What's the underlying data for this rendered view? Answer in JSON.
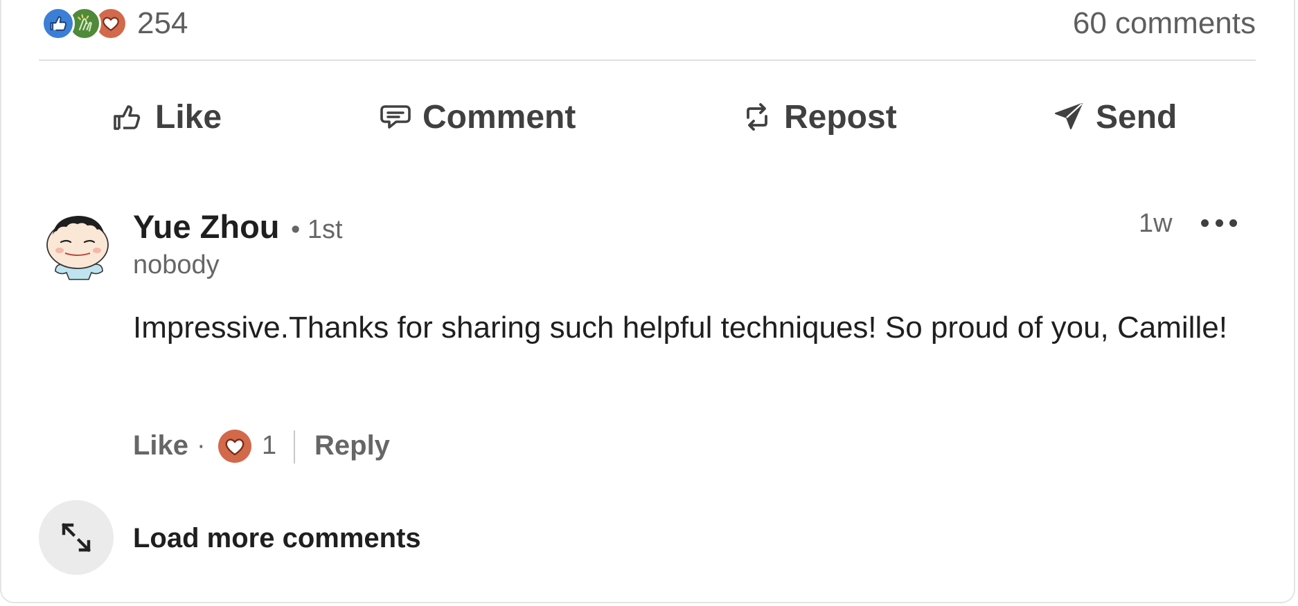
{
  "reactions": {
    "icons": [
      "like-reaction-icon",
      "celebrate-reaction-icon",
      "love-reaction-icon"
    ],
    "count": "254",
    "comments_count": "60 comments"
  },
  "actions": {
    "like": "Like",
    "comment": "Comment",
    "repost": "Repost",
    "send": "Send"
  },
  "comment": {
    "author": "Yue Zhou",
    "degree": "• 1st",
    "headline": "nobody",
    "time": "1w",
    "text": "Impressive.Thanks for sharing such helpful techniques! So proud of you, Camille!",
    "like_label": "Like",
    "separator": "·",
    "reaction_count": "1",
    "reply_label": "Reply"
  },
  "load_more": {
    "label": "Load more comments"
  },
  "colors": {
    "like_blue": "#3b7fd6",
    "celebrate_green": "#4e8a3a",
    "love_orange": "#d2694b",
    "text_secondary": "#666666"
  }
}
